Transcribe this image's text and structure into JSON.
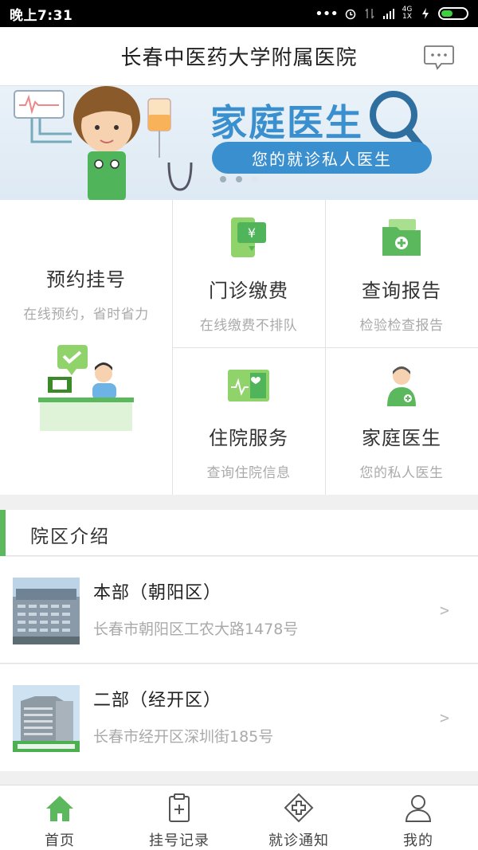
{
  "status_bar": {
    "time": "晚上7:31",
    "network": "4G 1X"
  },
  "header": {
    "title": "长春中医药大学附属医院"
  },
  "banner": {
    "heading": "家庭医生",
    "pill_text": "您的就诊私人医生",
    "page_count": 3,
    "active_page": 1
  },
  "services": [
    {
      "name": "预约挂号",
      "sub": "在线预约，省时省力"
    },
    {
      "name": "门诊缴费",
      "sub": "在线缴费不排队"
    },
    {
      "name": "查询报告",
      "sub": "检验检查报告"
    },
    {
      "name": "住院服务",
      "sub": "查询住院信息"
    },
    {
      "name": "家庭医生",
      "sub": "您的私人医生"
    }
  ],
  "section": {
    "title": "院区介绍"
  },
  "campuses": [
    {
      "name": "本部（朝阳区）",
      "address": "长春市朝阳区工农大路1478号"
    },
    {
      "name": "二部（经开区）",
      "address": "长春市经开区深圳街185号"
    }
  ],
  "bottom_nav": [
    {
      "label": "首页",
      "icon": "home-icon",
      "active": true
    },
    {
      "label": "挂号记录",
      "icon": "clipboard-plus-icon"
    },
    {
      "label": "就诊通知",
      "icon": "medical-cross-icon"
    },
    {
      "label": "我的",
      "icon": "user-icon"
    }
  ],
  "colors": {
    "accent": "#5cb85c",
    "banner_blue": "#3a8fcf",
    "header_text": "#222222"
  }
}
